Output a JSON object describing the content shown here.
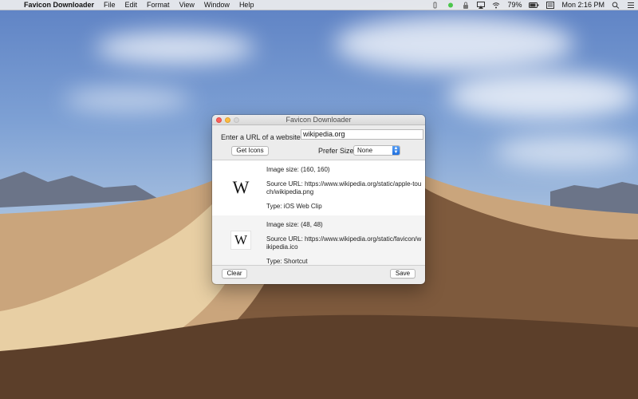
{
  "menubar": {
    "app_name": "Favicon Downloader",
    "menus": [
      "File",
      "Edit",
      "Format",
      "View",
      "Window",
      "Help"
    ],
    "battery": "79%",
    "clock": "Mon 2:16 PM"
  },
  "window": {
    "title": "Favicon Downloader",
    "url_label": "Enter a URL of a website:",
    "url_value": "wikipedia.org",
    "get_icons_label": "Get Icons",
    "prefer_size_label": "Prefer Size:",
    "prefer_size_value": "None",
    "clear_label": "Clear",
    "save_label": "Save"
  },
  "results": [
    {
      "glyph": "W",
      "image_size": "Image size: (160, 160)",
      "source_url": "Source URL: https://www.wikipedia.org/static/apple-touch/wikipedia.png",
      "type": "Type: iOS Web Clip"
    },
    {
      "glyph": "W",
      "image_size": "Image size: (48, 48)",
      "source_url": "Source URL: https://www.wikipedia.org/static/favicon/wikipedia.ico",
      "type": "Type: Shortcut"
    }
  ]
}
